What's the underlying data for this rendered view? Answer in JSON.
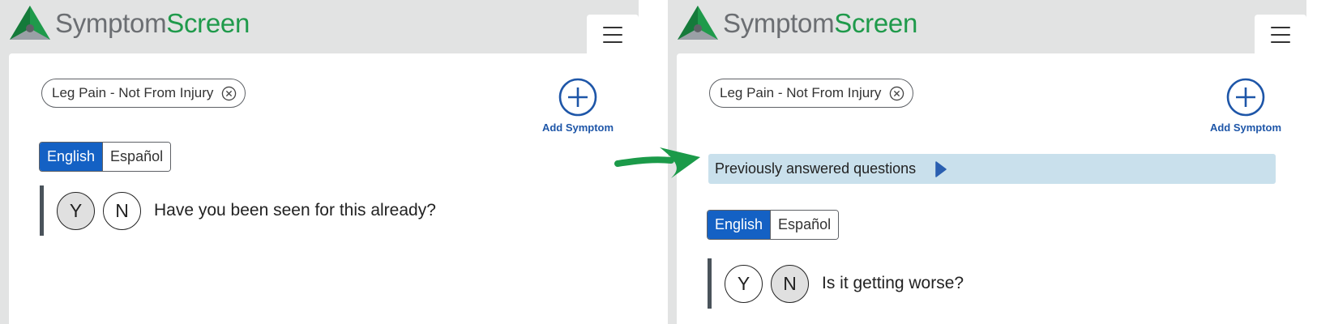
{
  "app": {
    "brand_part1": "Symptom",
    "brand_part2": "Screen"
  },
  "colors": {
    "brand_green": "#1f9a4b",
    "brand_gray": "#6b6e72",
    "accent_blue": "#1461c4",
    "prev_bg": "#c9e0ec"
  },
  "icons": {
    "logo": "triangle-logo-icon",
    "menu": "hamburger-menu-icon",
    "remove": "circle-x-icon",
    "add": "plus-circle-icon",
    "expand": "triangle-right-icon",
    "transition": "curved-arrow-icon"
  },
  "left": {
    "chip_label": "Leg Pain - Not From Injury",
    "add_label": "Add Symptom",
    "lang": {
      "english": "English",
      "espanol": "Español",
      "selected": "English"
    },
    "question": {
      "yes": "Y",
      "no": "N",
      "text": "Have you been seen for this already?",
      "selected": "Y"
    }
  },
  "right": {
    "chip_label": "Leg Pain - Not From Injury",
    "add_label": "Add Symptom",
    "prev_label": "Previously answered questions",
    "lang": {
      "english": "English",
      "espanol": "Español",
      "selected": "English"
    },
    "question": {
      "yes": "Y",
      "no": "N",
      "text": "Is it getting worse?",
      "selected": "N"
    }
  }
}
